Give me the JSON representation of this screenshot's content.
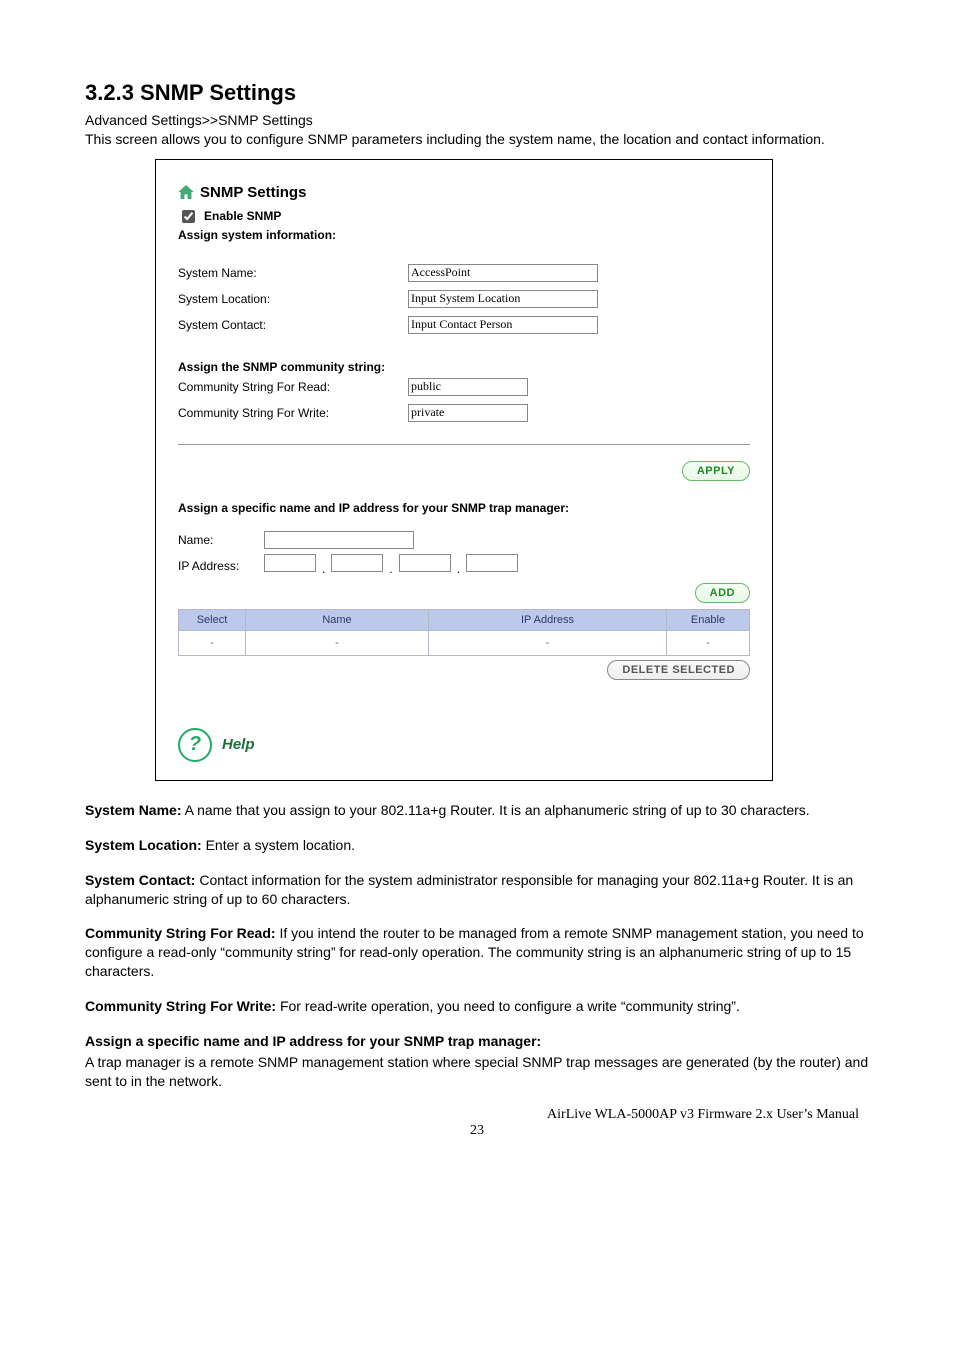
{
  "heading": "3.2.3 SNMP Settings",
  "breadcrumb": "Advanced Settings>>SNMP Settings",
  "intro": "This screen allows you to configure SNMP parameters including the system name, the location and contact information.",
  "panel": {
    "title": "SNMP Settings",
    "enable_label": "Enable SNMP",
    "assign_info_label": "Assign system information:",
    "system_name_label": "System Name:",
    "system_name_value": "AccessPoint",
    "system_location_label": "System Location:",
    "system_location_value": "Input System Location",
    "system_contact_label": "System Contact:",
    "system_contact_value": "Input Contact Person",
    "community_heading": "Assign the SNMP community string:",
    "community_read_label": "Community String For Read:",
    "community_read_value": "public",
    "community_write_label": "Community String For Write:",
    "community_write_value": "private",
    "apply_label": "APPLY",
    "trap_heading": "Assign a specific name and IP address for your SNMP trap manager:",
    "trap_name_label": "Name:",
    "trap_ip_label": "IP Address:",
    "add_label": "ADD",
    "table": {
      "headers": {
        "select": "Select",
        "name": "Name",
        "ip": "IP Address",
        "enable": "Enable"
      },
      "row": {
        "select": "-",
        "name": "-",
        "ip": "-",
        "enable": "-"
      }
    },
    "delete_label": "DELETE SELECTED",
    "help_label": "Help"
  },
  "descriptions": {
    "system_name_term": "System Name:",
    "system_name_text": " A name that you assign to your 802.11a+g Router. It is an alphanumeric string of up to 30 characters.",
    "system_location_term": "System Location:",
    "system_location_text": " Enter a system location.",
    "system_contact_term": "System Contact:",
    "system_contact_text": " Contact information for the system administrator responsible for managing your 802.11a+g Router. It is an alphanumeric string of up to 60 characters.",
    "community_read_term": "Community String For Read:",
    "community_read_text": " If you intend the router to be managed from a remote SNMP management station, you need to configure a read-only “community string” for read-only operation. The community string is an alphanumeric string of up to 15 characters.",
    "community_write_term": "Community String For Write:",
    "community_write_text": " For read-write operation, you need to configure a write “community string”.",
    "trap_heading_term": "Assign a specific name and IP address for your SNMP trap manager:",
    "trap_text": "A trap manager is a remote SNMP management station where special SNMP trap messages are generated (by the router) and sent to in the network."
  },
  "footer": {
    "manual": "AirLive WLA-5000AP v3 Firmware 2.x User’s Manual",
    "page": "23"
  }
}
